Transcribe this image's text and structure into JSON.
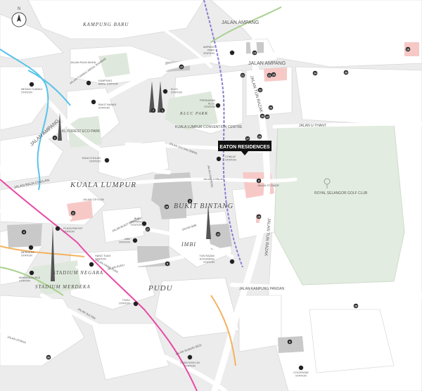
{
  "compass": {
    "label": "N"
  },
  "areas": {
    "kampung_baru": "KAMPUNG BARU",
    "kuala_lumpur": "KUALA LUMPUR",
    "bukit_bintang": "BUKIT BINTANG",
    "imbi": "IMBI",
    "pudu": "PUDU",
    "stadium_negara": "STADIUM NEGARA",
    "stadium_merdeka": "STADIUM MERDEKA"
  },
  "roads": {
    "jalan_ampang_top": "JALAN AMPANG",
    "jalan_ampang_mid": "JALAN AMPANG",
    "jalan_ampang_left": "JALAN AMPANG",
    "jalan_tun_razak": "JALAN TUN RAZAK",
    "jalan_tun_razak_south": "JALAN TUN RAZAK",
    "jalan_u_thant": "JALAN U-THANT",
    "jalan_raja_chulan": "JALAN RAJA CHULAN",
    "jalan_kampung_pandan": "JALAN KAMPUNG PANDAN",
    "jalan_sultan_ismail": "JALAN SULTAN ISMAIL",
    "jalan_conlay": "JALAN CONLAY",
    "jalan_ceylon": "JALAN CEYLON",
    "jalan_imbi": "JALAN IMBI",
    "jalan_pudu": "JALAN PUDU",
    "jalan_bukit_bintang": "JALAN BUKIT BINTANG",
    "jalan_istana": "JALAN ISTANA",
    "jalan_kia_peng": "JALAN KIA PENG",
    "jalan_stonor": "JALAN STONOR",
    "jalan_tuanku_abdul_rahman": "JALAN TUANKU ABDUL RAHMAN",
    "jalan_hang_tuah": "JALAN HANG TUAH",
    "jalan_sultan": "JALAN SULTAN",
    "jalan_sungei_besi": "JALAN SUNGEI BESI",
    "jalan_raja_muda": "JALAN RAJA MUDA"
  },
  "places": {
    "klcc_park": "KLCC PARK",
    "convention_centre": "KUALA LUMPUR\nCONVENTION CENTRE",
    "kl_forest": "KL FOREST\nECO PARK",
    "royal_selangor": "ROYAL SELANGOR\nGOLF CLUB"
  },
  "stations": [
    {
      "id": "ampang_park",
      "label": "AMPANG\nPARK\nSTATION"
    },
    {
      "id": "kampung_baru",
      "label": "KAMPUNG\nBARU STATION"
    },
    {
      "id": "medan_tuanku",
      "label": "MEDAN TUANKU\nSTATION"
    },
    {
      "id": "bukit_nanas",
      "label": "BUKIT NANAS\nSTATION"
    },
    {
      "id": "klcc",
      "label": "KLCC\nSTATION"
    },
    {
      "id": "persiaran_klcc",
      "label": "PERSIARAN\nKLCC\nSTATION"
    },
    {
      "id": "raja_chulan",
      "label": "RAJA CHULAN\nSTATION"
    },
    {
      "id": "conlay",
      "label": "CONLAY\nSTATION"
    },
    {
      "id": "plaza_rakyat",
      "label": "PLAZA RAKYAT\nSTATION"
    },
    {
      "id": "bukit_bintang",
      "label": "BUKIT\nBINTANG\nSTATION"
    },
    {
      "id": "imbi",
      "label": "IMBI\nSTATION"
    },
    {
      "id": "merdeka",
      "label": "MERDEKA\nSTATION"
    },
    {
      "id": "hang_tuah",
      "label": "HANG TUAH\nSTATION"
    },
    {
      "id": "maharajalela",
      "label": "MAHARAJALELA\nSTATION"
    },
    {
      "id": "tun_razak_exchange",
      "label": "TUN RAZAK\nEXCHANGE\nSTATION"
    },
    {
      "id": "pudu",
      "label": "PUDU\nSTATION"
    },
    {
      "id": "chan_sow_lin",
      "label": "CHAN SOW LIN\nSTATION"
    },
    {
      "id": "cochrane",
      "label": "COCHRANE\nSTATION"
    }
  ],
  "destination": {
    "label": "EATON RESIDENCES",
    "color": "#111111"
  },
  "pins": [
    "1",
    "2",
    "3",
    "4",
    "5",
    "6",
    "7",
    "8",
    "9",
    "10",
    "11",
    "12",
    "13",
    "14",
    "15",
    "16",
    "17",
    "18",
    "19",
    "20",
    "21",
    "22",
    "23",
    "24",
    "25",
    "26",
    "27",
    "28",
    "29",
    "30"
  ],
  "colors": {
    "background": "#ececec",
    "block": "#ffffff",
    "major_road": "#ffffff",
    "park": "#dfe8dc",
    "building": "#c9c9c9",
    "hotspot": "#f6c9c7",
    "river": "#57c3ea",
    "rail_magenta": "#e84aa5",
    "rail_purple": "#8a80d0",
    "rail_orange": "#f4b25f",
    "rail_green": "#a9d18e",
    "pin": "#2b2b2b"
  },
  "icons": [
    "compass-icon",
    "train-station-icon",
    "shopping-bag-icon",
    "tower-icon",
    "golf-pin-icon",
    "location-pin-icon"
  ]
}
